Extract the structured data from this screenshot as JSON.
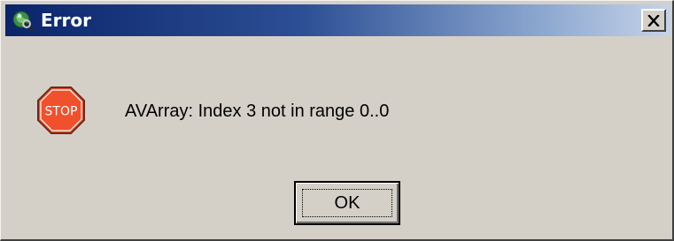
{
  "window": {
    "title": "Error",
    "close_glyph": "✕"
  },
  "dialog": {
    "icon": "stop-icon",
    "icon_text": "STOP",
    "message": "AVArray: Index 3 not in range 0..0",
    "ok_label": "OK"
  },
  "colors": {
    "titlebar_start": "#0a246a",
    "titlebar_end": "#c6d3e8",
    "stop_fill": "#f0502b",
    "face": "#d4d0c8"
  }
}
